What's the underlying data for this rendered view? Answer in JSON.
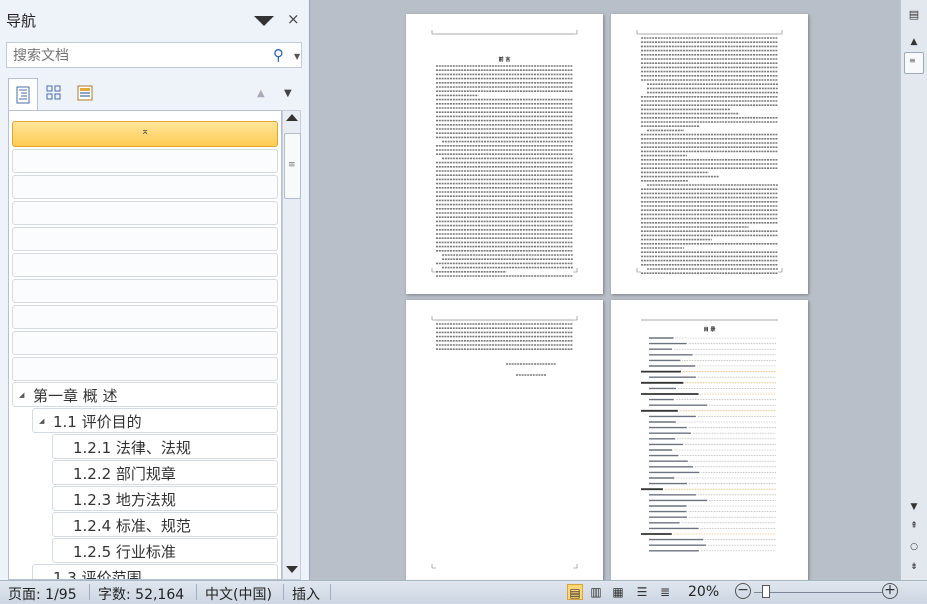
{
  "nav": {
    "title": "导航",
    "close": "×",
    "search_placeholder": "搜索文档",
    "selected_thumb_glyph": "⌅",
    "headings": [
      {
        "label": "第一章 概 述",
        "level": 1,
        "collapsed": false
      },
      {
        "label": "1.1 评价目的",
        "level": 2,
        "collapsed": false
      },
      {
        "label": "1.2.1  法律、法规",
        "level": 3
      },
      {
        "label": "1.2.2  部门规章",
        "level": 3
      },
      {
        "label": "1.2.3  地方法规",
        "level": 3
      },
      {
        "label": "1.2.4  标准、规范",
        "level": 3
      },
      {
        "label": "1.2.5  行业标准",
        "level": 3
      },
      {
        "label": "1.3 评价范围",
        "level": 2
      }
    ]
  },
  "document": {
    "page1_title": "前    言",
    "page4_title": "目    录"
  },
  "status": {
    "page": "页面: 1/95",
    "words": "字数: 52,164",
    "language": "中文(中国)",
    "mode": "插入",
    "zoom": "20%"
  }
}
